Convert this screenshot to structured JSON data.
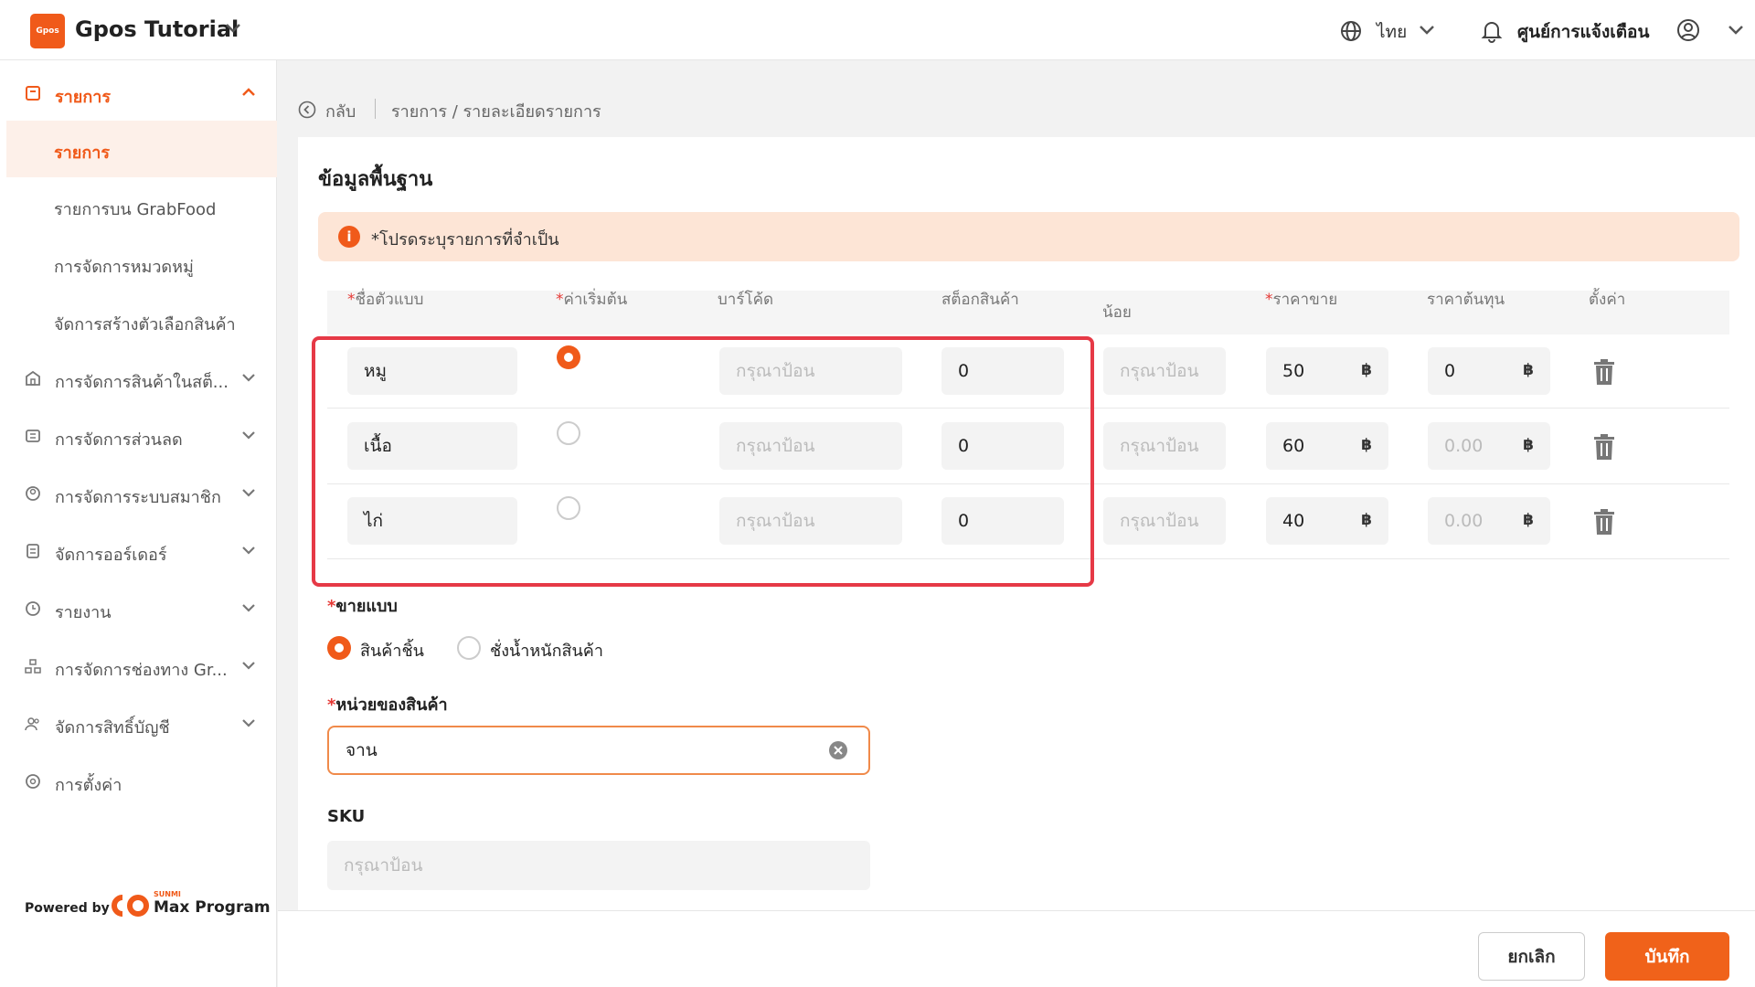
{
  "header": {
    "logo_text": "Gpos",
    "app_title": "Gpos Tutorial",
    "language": "ไทย",
    "notification_center": "ศูนย์การแจ้งเตือน",
    "accent_color": "#f05a1a"
  },
  "sidebar": {
    "section": "รายการ",
    "sub_items": [
      "รายการ",
      "รายการบน GrabFood",
      "การจัดการหมวดหมู่",
      "จัดการสร้างตัวเลือกสินค้า"
    ],
    "items": [
      {
        "label": "การจัดการสินค้าในสต็...",
        "icon": "store-icon"
      },
      {
        "label": "การจัดการส่วนลด",
        "icon": "discount-icon"
      },
      {
        "label": "การจัดการระบบสมาชิก",
        "icon": "member-icon"
      },
      {
        "label": "จัดการออร์เดอร์",
        "icon": "order-icon"
      },
      {
        "label": "รายงาน",
        "icon": "report-icon"
      },
      {
        "label": "การจัดการช่องทาง Gr...",
        "icon": "channel-icon"
      },
      {
        "label": "จัดการสิทธิ์บัญชี",
        "icon": "account-icon"
      },
      {
        "label": "การตั้งค่า",
        "icon": "settings-icon"
      }
    ],
    "powered_by": "Powered by",
    "brand_small": "SUNMI",
    "brand_name": "Max Program"
  },
  "breadcrumb": {
    "back": "กลับ",
    "path": "รายการ / รายละเอียดรายการ"
  },
  "form": {
    "section_title": "ข้อมูลพื้นฐาน",
    "alert": "*โปรดระบุรายการที่จำเป็น",
    "table": {
      "headers": {
        "name": "ชื่อตัวแบบ",
        "default": "ค่าเริ่มต้น",
        "barcode": "บาร์โค้ด",
        "stock": "สต็อกสินค้า",
        "min": "น้อย",
        "price": "ราคาขาย",
        "cost": "ราคาต้นทุน",
        "actions": "ตั้งค่า"
      },
      "required_mark": "*",
      "rows": [
        {
          "name": "หมู",
          "barcode_placeholder": "กรุณาป้อน",
          "stock": "0",
          "min_placeholder": "กรุณาป้อน",
          "price": "50",
          "cost": "0",
          "cost_is_placeholder": false
        },
        {
          "name": "เนื้อ",
          "barcode_placeholder": "กรุณาป้อน",
          "stock": "0",
          "min_placeholder": "กรุณาป้อน",
          "price": "60",
          "cost": "0.00",
          "cost_is_placeholder": true
        },
        {
          "name": "ไก่",
          "barcode_placeholder": "กรุณาป้อน",
          "stock": "0",
          "min_placeholder": "กรุณาป้อน",
          "price": "40",
          "cost": "0.00",
          "cost_is_placeholder": true
        }
      ],
      "currency": "฿"
    },
    "sell_by": {
      "label": "ขายแบบ",
      "option_piece": "สินค้าชิ้น",
      "option_weight": "ชั่งน้ำหนักสินค้า"
    },
    "unit": {
      "label": "หน่วยของสินค้า",
      "value": "จาน"
    },
    "sku": {
      "label": "SKU",
      "placeholder": "กรุณาป้อน"
    }
  },
  "footer": {
    "cancel": "ยกเลิก",
    "save": "บันทึก"
  }
}
